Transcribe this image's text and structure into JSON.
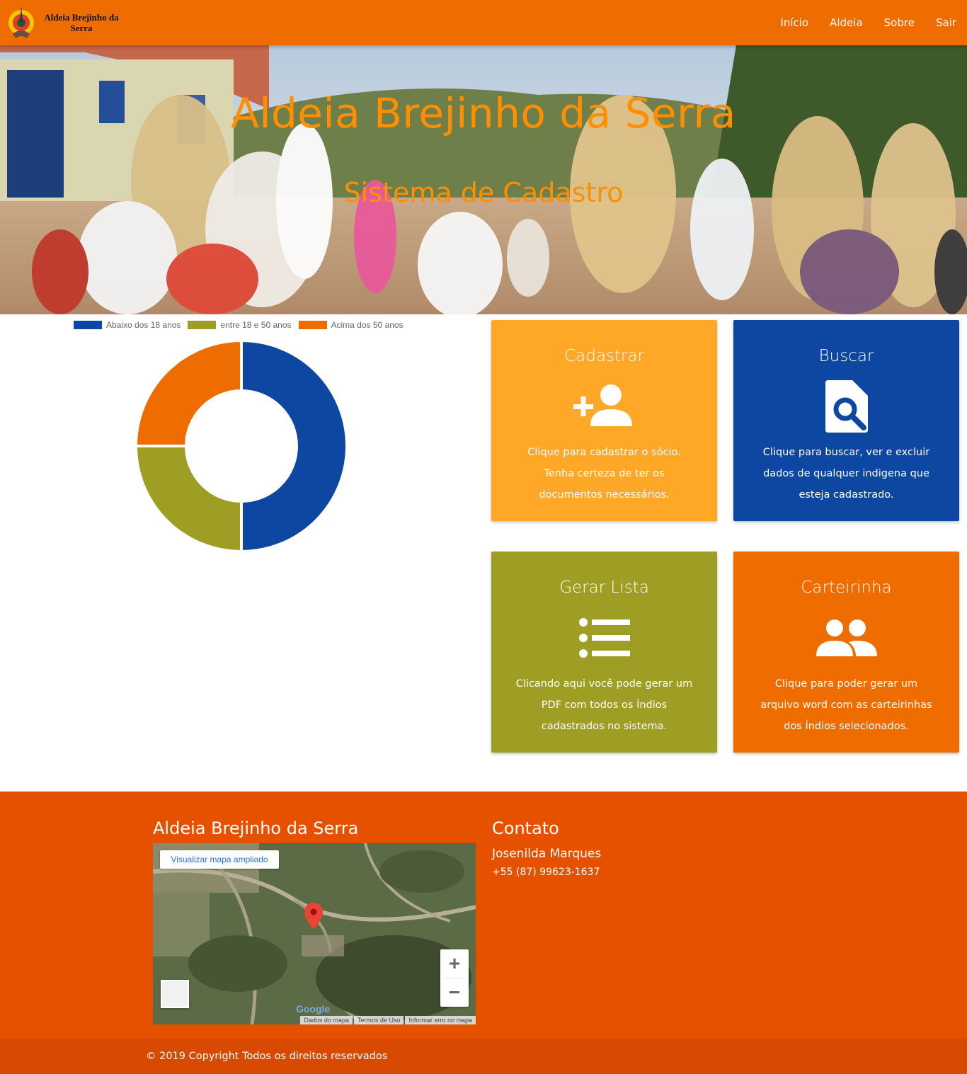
{
  "brand": {
    "name": "Aldeia Brejinho da Serra",
    "logo_icon": "feather-headdress-icon"
  },
  "nav": {
    "items": [
      "Início",
      "Aldeia",
      "Sobre",
      "Sair"
    ]
  },
  "hero": {
    "title": "Aldeia Brejinho da Serra",
    "subtitle": "Sistema de Cadastro"
  },
  "chart_data": {
    "type": "doughnut",
    "legend_position": "top",
    "series": [
      {
        "name": "Abaixo dos 18 anos",
        "value": 50,
        "color": "#0d47a1"
      },
      {
        "name": "entre 18 e 50 anos",
        "value": 25,
        "color": "#9e9d24"
      },
      {
        "name": "Acima dos 50 anos",
        "value": 25,
        "color": "#ef6c00"
      }
    ]
  },
  "cards": [
    {
      "title": "Cadastrar",
      "icon": "person-add-icon",
      "color": "#ffa726",
      "text": "Clique para cadastrar o sócio. Tenha certeza de ter os documentos necessários."
    },
    {
      "title": "Buscar",
      "icon": "find-in-page-icon",
      "color": "#0d47a1",
      "text": "Clique para buscar, ver e excluir dados de qualquer indigena que esteja cadastrado."
    },
    {
      "title": "Gerar Lista",
      "icon": "list-icon",
      "color": "#9e9d24",
      "text": "Clicando aqui você pode gerar um PDF com todos os Índios cadastrados no sistema."
    },
    {
      "title": "Carteirinha",
      "icon": "people-icon",
      "color": "#ef6c00",
      "text": "Clique para poder gerar um arquivo word com as carteirinhas dos Índios selecionados."
    }
  ],
  "footer": {
    "aldeia_title": "Aldeia Brejinho da Serra",
    "map": {
      "view_larger": "Visualizar mapa ampliado",
      "google": "Google",
      "footer_links": [
        "Dados do mapa",
        "Termos de Uso",
        "Informar erro no mapa"
      ],
      "zoom_in": "+",
      "zoom_out": "−"
    },
    "contact_title": "Contato",
    "contact_name": "Josenilda Marques",
    "contact_phone": "+55 (87) 99623-1637",
    "copyright": "© 2019 Copyright Todos os direitos reservados"
  }
}
